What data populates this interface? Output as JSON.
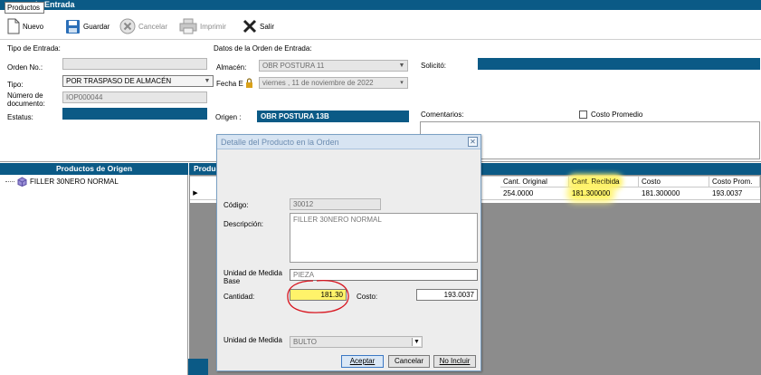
{
  "window": {
    "title": "de Entrada",
    "tooltip": "Productos"
  },
  "toolbar": {
    "nuevo": "Nuevo",
    "guardar": "Guardar",
    "cancelar": "Cancelar",
    "imprimir": "Imprimir",
    "salir": "Salir"
  },
  "form": {
    "tipo_entrada_heading": "Tipo de Entrada:",
    "datos_heading": "Datos de la Orden de Entrada:",
    "orden_no_label": "Orden No.:",
    "orden_no_value": "",
    "tipo_label": "Tipo:",
    "tipo_value": "POR TRASPASO DE ALMACÉN",
    "numero_doc_label": "Número de documento:",
    "numero_doc_value": "IOP000044",
    "estatus_label": "Estatus:",
    "almacen_label": "Almacén:",
    "almacen_value": "OBR POSTURA 11",
    "fecha_label": "Fecha E",
    "fecha_value": "viernes , 11 de noviembre de 2022",
    "origen_label": "Origen :",
    "origen_value": "OBR POSTURA 13B",
    "solicito_label": "Solicitó:",
    "comentarios_label": "Comentarios:",
    "costo_promedio_label": "Costo Promedio"
  },
  "origin_panel": {
    "title": "Productos de Origen",
    "tree_item": "FILLER 30NERO NORMAL"
  },
  "grid_panel": {
    "title": "Produc",
    "headers": [
      "Cant. Original",
      "Cant. Recibida",
      "Costo",
      "Costo Prom."
    ],
    "row": {
      "cant_original": "254.0000",
      "cant_recibida": "181.300000",
      "costo": "181.300000",
      "costo_prom": "193.0037"
    }
  },
  "dialog": {
    "title": "Detalle del Producto en la Orden",
    "codigo_label": "Código:",
    "codigo_value": "30012",
    "descripcion_label": "Descripción:",
    "descripcion_value": "FILLER 30NERO NORMAL",
    "unidad_base_label": "Unidad de Medida Base",
    "unidad_base_value": "PIEZA",
    "cantidad_label": "Cantidad:",
    "cantidad_value": "181.30",
    "costo_label": "Costo:",
    "costo_value": "193.0037",
    "unidad_label": "Unidad de Medida",
    "unidad_value": "BULTO",
    "aceptar": "Aceptar",
    "cancelar": "Cancelar",
    "no_incluir": "No Incluir"
  },
  "colors": {
    "header_blue": "#0b5a86",
    "highlight": "#fff36a",
    "annotation_red": "#d8141e"
  }
}
